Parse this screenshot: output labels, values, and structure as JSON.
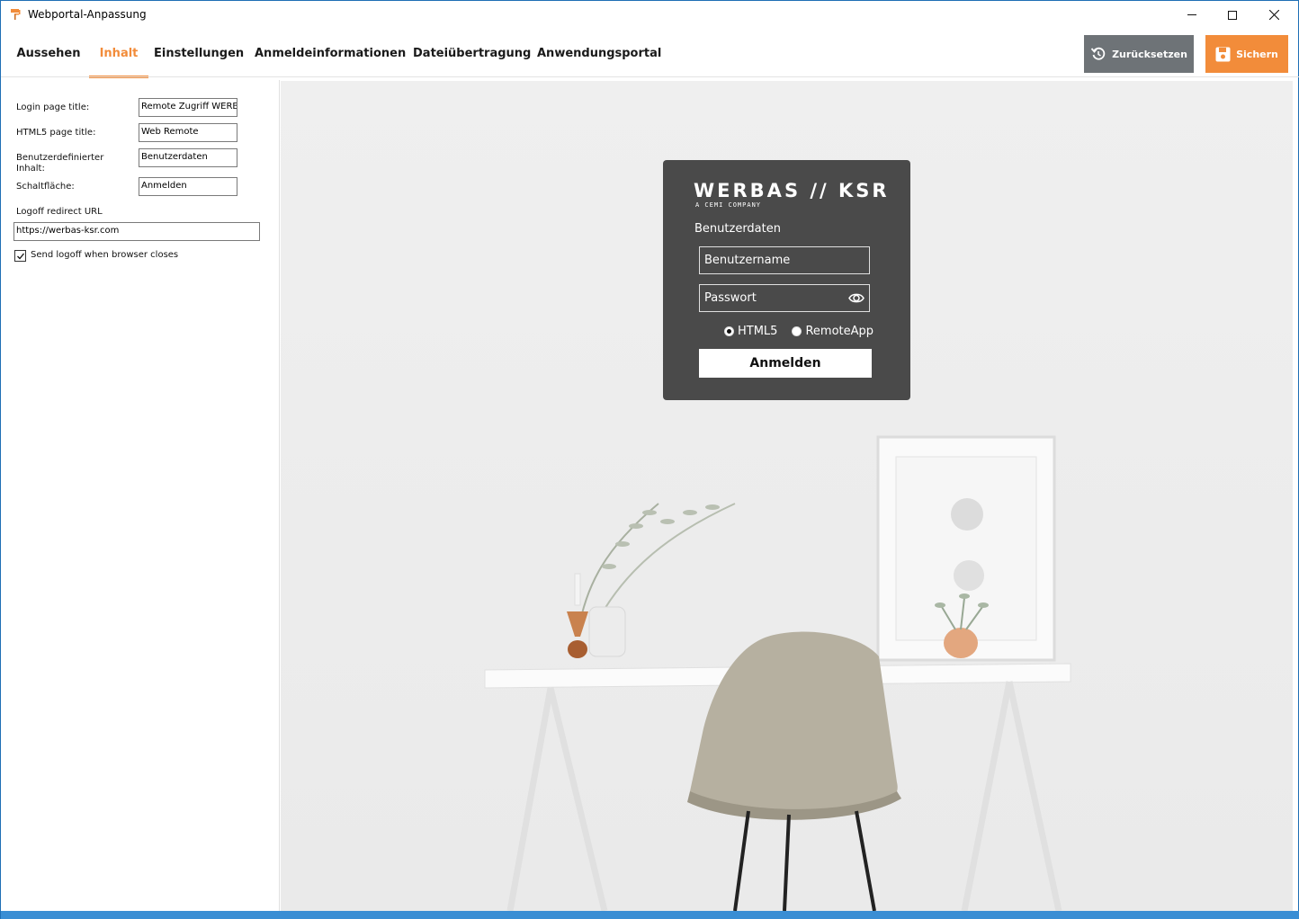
{
  "window": {
    "title": "Webportal-Anpassung"
  },
  "tabs": [
    {
      "label": "Aussehen"
    },
    {
      "label": "Inhalt"
    },
    {
      "label": "Einstellungen"
    },
    {
      "label": "Anmeldeinformationen"
    },
    {
      "label": "Dateiübertragung"
    },
    {
      "label": "Anwendungsportal"
    }
  ],
  "active_tab": "Inhalt",
  "toolbar": {
    "reset_label": "Zurücksetzen",
    "save_label": "Sichern"
  },
  "form": {
    "login_title_label": "Login page title:",
    "login_title_value": "Remote Zugriff WERBAS",
    "html5_title_label": "HTML5 page title:",
    "html5_title_value": "Web Remote",
    "custom_content_label": "Benutzerdefinierter Inhalt:",
    "custom_content_value": "Benutzerdaten",
    "button_label": "Schaltfläche:",
    "button_value": "Anmelden",
    "logoff_url_label": "Logoff redirect URL",
    "logoff_url_value": "https://werbas-ksr.com",
    "send_logoff_label": "Send logoff when browser closes",
    "send_logoff_checked": true
  },
  "preview": {
    "logo_text": "WERBAS // KSR",
    "logo_sub": "A CEMI COMPANY",
    "heading": "Benutzerdaten",
    "username_placeholder": "Benutzername",
    "password_placeholder": "Passwort",
    "radio_html5": "HTML5",
    "radio_remoteapp": "RemoteApp",
    "selected_mode": "HTML5",
    "login_button": "Anmelden"
  },
  "colors": {
    "accent": "#f28c3a",
    "reset_button": "#6e7377",
    "login_panel": "#4a4a4a"
  }
}
